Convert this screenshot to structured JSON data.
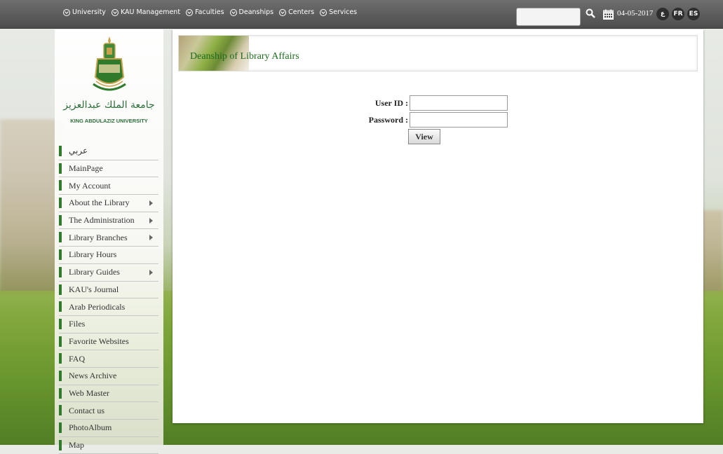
{
  "topbar": {
    "nav": [
      {
        "label": "University"
      },
      {
        "label": "KAU Management"
      },
      {
        "label": "Faculties"
      },
      {
        "label": "Deanships"
      },
      {
        "label": "Centers"
      },
      {
        "label": "Services"
      }
    ],
    "search": {
      "value": "",
      "placeholder": ""
    },
    "date": "04-05-2017",
    "languages": [
      {
        "label": "ع"
      },
      {
        "label": "FR"
      },
      {
        "label": "ES"
      }
    ]
  },
  "sidebar": {
    "logo_arabic": "جامعة الملك عبدالعزيز",
    "logo_english": "KING ABDULAZIZ UNIVERSITY",
    "items": [
      {
        "label": "عربي"
      },
      {
        "label": "MainPage"
      },
      {
        "label": "My Account"
      },
      {
        "label": "About the Library"
      },
      {
        "label": "The Administration"
      },
      {
        "label": "Library Branches"
      },
      {
        "label": "Library Hours"
      },
      {
        "label": "Library Guides"
      },
      {
        "label": "KAU's Journal"
      },
      {
        "label": "Arab Periodicals"
      },
      {
        "label": "Files"
      },
      {
        "label": "Favorite Websites"
      },
      {
        "label": "FAQ"
      },
      {
        "label": "News Archive"
      },
      {
        "label": "Web Master"
      },
      {
        "label": "Contact us"
      },
      {
        "label": "PhotoAlbum"
      },
      {
        "label": "Map"
      }
    ]
  },
  "main": {
    "banner_title": "Deanship of Library Affairs",
    "form": {
      "user_label": "User ID :",
      "user_value": "",
      "password_label": "Password :",
      "password_value": "",
      "submit_label": "View"
    }
  },
  "colors": {
    "accent_green": "#2f7a2b",
    "topbar": "#555555"
  }
}
